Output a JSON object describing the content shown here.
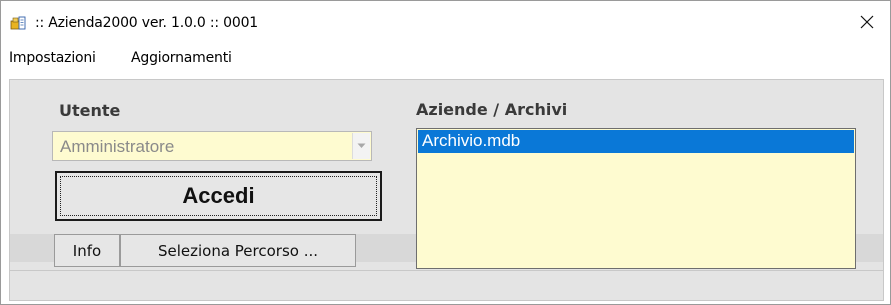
{
  "window": {
    "title": ":: Azienda2000  ver. 1.0.0 :: 0001",
    "icon": "app-folder-icon",
    "close_glyph": "×"
  },
  "menu": {
    "items": [
      "Impostazioni",
      "Aggiornamenti"
    ]
  },
  "login": {
    "user_label": "Utente",
    "user_value": "Amministratore",
    "user_dropdown_icon": "chevron-down-icon",
    "login_button": "Accedi",
    "info_button": "Info",
    "path_button": "Seleziona Percorso ..."
  },
  "archives": {
    "label": "Aziende / Archivi",
    "items": [
      "Archivio.mdb"
    ],
    "selected_index": 0
  },
  "colors": {
    "field_bg": "#fefbd0",
    "selection": "#0a78d7",
    "panel_bg": "#e4e4e4"
  }
}
